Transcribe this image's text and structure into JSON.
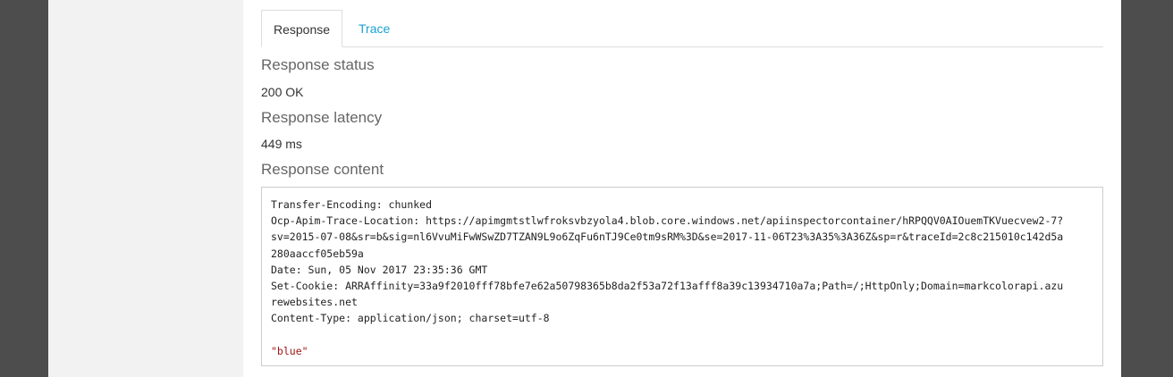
{
  "tabs": [
    {
      "label": "Response",
      "active": true
    },
    {
      "label": "Trace",
      "active": false
    }
  ],
  "sections": {
    "status": {
      "title": "Response status",
      "value": "200 OK"
    },
    "latency": {
      "title": "Response latency",
      "value": "449 ms"
    },
    "content": {
      "title": "Response content"
    }
  },
  "response_content": {
    "lines": [
      "Transfer-Encoding: chunked",
      "Ocp-Apim-Trace-Location: https://apimgmtstlwfroksvbzyola4.blob.core.windows.net/apiinspectorcontainer/hRPQQV0AIOuemTKVuecvew2-7?",
      "sv=2015-07-08&sr=b&sig=nl6VvuMiFwWSwZD7TZAN9L9o6ZqFu6nTJ9Ce0tm9sRM%3D&se=2017-11-06T23%3A35%3A36Z&sp=r&traceId=2c8c215010c142d5a",
      "280aaccf05eb59a",
      "Date: Sun, 05 Nov 2017 23:35:36 GMT",
      "Set-Cookie: ARRAffinity=33a9f2010fff78bfe7e62a50798365b8da2f53a72f13afff8a39c13934710a7a;Path=/;HttpOnly;Domain=markcolorapi.azu",
      "rewebsites.net",
      "Content-Type: application/json; charset=utf-8"
    ],
    "body": "\"blue\""
  },
  "colors": {
    "link": "#1aa1d6",
    "body_string": "#a31515",
    "frame": "#4d4d4d"
  }
}
